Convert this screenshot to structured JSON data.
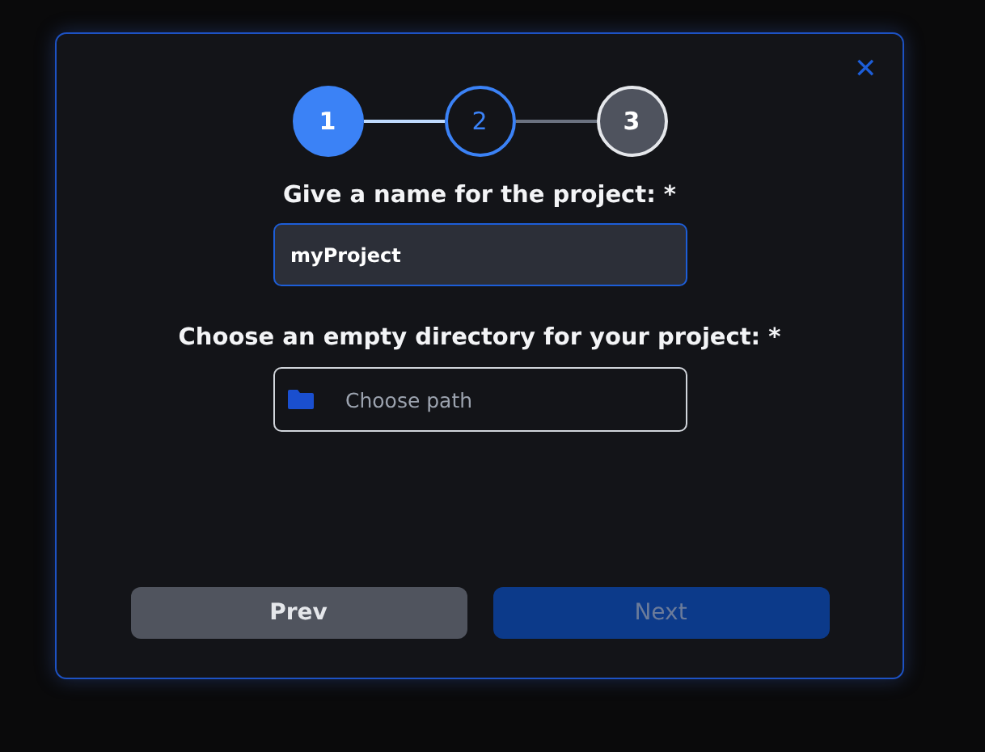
{
  "close_button": {
    "label": "✕"
  },
  "steps": [
    {
      "label": "1",
      "kind": "active"
    },
    {
      "label": "2",
      "kind": "next"
    },
    {
      "label": "3",
      "kind": "pending"
    }
  ],
  "name_field": {
    "label": "Give a name for the project: *",
    "value": "myProject"
  },
  "directory_field": {
    "label": "Choose an empty directory for your project: *",
    "placeholder": "Choose path"
  },
  "buttons": [
    {
      "label": "Prev",
      "disabled": false,
      "kind": "secondary"
    },
    {
      "label": "Next",
      "disabled": true,
      "kind": "primary"
    }
  ]
}
